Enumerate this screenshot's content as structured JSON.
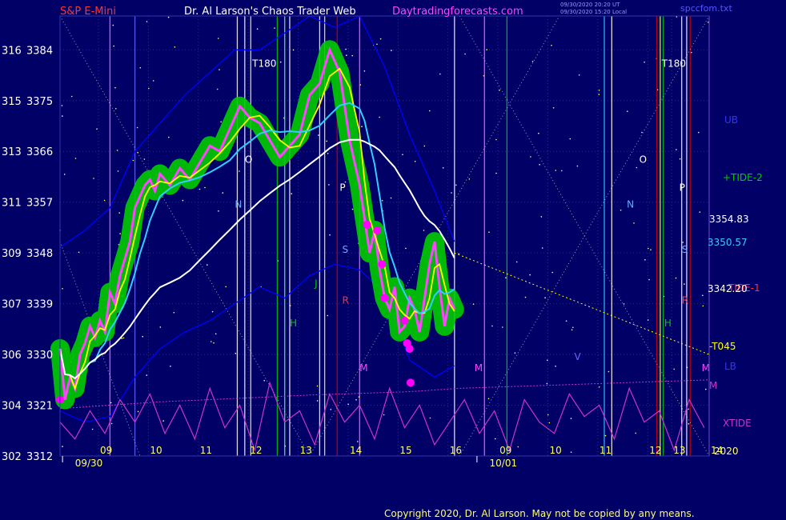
{
  "header": {
    "left": "S&P E-Mini",
    "center": "Dr. Al Larson's Chaos Trader Web",
    "site": "Daytradingforecasts.com",
    "stamp1": "09/30/2020 20:20 UT",
    "stamp2": "09/30/2020 15:20 Local",
    "file": "spccfom.txt"
  },
  "copyright": "Copyright 2020, Dr. Al Larson. May not be copied by any means.",
  "colors": {
    "background": "#000066",
    "price_green": "#00cc00",
    "price_line": "#ffff00",
    "fast_ma": "#33ccff",
    "slow_ma": "#ffffff",
    "band": "#0000ff",
    "tide2": "#00cc00",
    "xtide": "#cc33cc",
    "red_line": "#cc0000",
    "magenta_dot": "#ff00ff"
  },
  "chart_data": {
    "type": "line",
    "title": "S&P E-Mini",
    "ylim": [
      3312,
      3390
    ],
    "y_ticks": [
      {
        "left": "302",
        "right": "3312",
        "v": 3312
      },
      {
        "left": "304",
        "right": "3321",
        "v": 3321
      },
      {
        "left": "306",
        "right": "3330",
        "v": 3330
      },
      {
        "left": "307",
        "right": "3339",
        "v": 3339
      },
      {
        "left": "309",
        "right": "3348",
        "v": 3348
      },
      {
        "left": "311",
        "right": "3357",
        "v": 3357
      },
      {
        "left": "313",
        "right": "3366",
        "v": 3366
      },
      {
        "left": "315",
        "right": "3375",
        "v": 3375
      },
      {
        "left": "316",
        "right": "3384",
        "v": 3384
      }
    ],
    "x_range": [
      8,
      21
    ],
    "x_ticks": [
      {
        "t": 8.77,
        "label": "09"
      },
      {
        "t": 9.77,
        "label": "10"
      },
      {
        "t": 10.77,
        "label": "11"
      },
      {
        "t": 11.77,
        "label": "12"
      },
      {
        "t": 12.77,
        "label": "13"
      },
      {
        "t": 13.77,
        "label": "14"
      },
      {
        "t": 14.77,
        "label": "15"
      },
      {
        "t": 15.77,
        "label": "16"
      },
      {
        "t": 16.77,
        "label": "09"
      },
      {
        "t": 17.77,
        "label": "10"
      },
      {
        "t": 18.77,
        "label": "11"
      },
      {
        "t": 19.77,
        "label": "12"
      },
      {
        "t": 20.25,
        "label": "13"
      },
      {
        "t": 21.0,
        "label": "14"
      }
    ],
    "dates": [
      {
        "t": 8.3,
        "label": "09/30"
      },
      {
        "t": 16.6,
        "label": "10/01"
      }
    ],
    "year": "2020",
    "series": [
      {
        "name": "price",
        "x": [
          8.0,
          8.1,
          8.2,
          8.3,
          8.4,
          8.5,
          8.6,
          8.7,
          8.8,
          8.9,
          9.0,
          9.1,
          9.2,
          9.3,
          9.4,
          9.5,
          9.6,
          9.7,
          9.8,
          9.9,
          10.0,
          10.2,
          10.4,
          10.6,
          10.8,
          11.0,
          11.2,
          11.4,
          11.6,
          11.8,
          12.0,
          12.2,
          12.4,
          12.6,
          12.8,
          13.0,
          13.2,
          13.4,
          13.6,
          13.8,
          14.0,
          14.1,
          14.2,
          14.3,
          14.4,
          14.5,
          14.6,
          14.7,
          14.8,
          14.9,
          15.0,
          15.1,
          15.2,
          15.3,
          15.4,
          15.5,
          15.6,
          15.7,
          15.8,
          15.9
        ],
        "values": [
          3331,
          3322,
          3326,
          3324,
          3330,
          3332,
          3335,
          3333,
          3336,
          3334,
          3341,
          3339,
          3344,
          3347,
          3350,
          3356,
          3358,
          3360,
          3361,
          3359,
          3362,
          3360,
          3363,
          3361,
          3364,
          3367,
          3366,
          3370,
          3374,
          3372,
          3371,
          3368,
          3365,
          3367,
          3369,
          3376,
          3378,
          3384,
          3380,
          3368,
          3360,
          3354,
          3348,
          3352,
          3345,
          3340,
          3338,
          3342,
          3334,
          3335,
          3340,
          3338,
          3334,
          3340,
          3346,
          3350,
          3342,
          3335,
          3340,
          3338
        ]
      },
      {
        "name": "UB",
        "x": [
          8.0,
          8.5,
          9.0,
          9.5,
          10.0,
          10.5,
          11.0,
          11.5,
          12.0,
          12.5,
          13.0,
          13.5,
          14.0,
          14.5,
          15.0,
          15.5,
          15.9
        ],
        "values": [
          3349,
          3352,
          3356,
          3366,
          3371,
          3376,
          3380,
          3384,
          3384,
          3387,
          3390,
          3388,
          3390,
          3381,
          3369,
          3359,
          3350
        ]
      },
      {
        "name": "LB",
        "x": [
          8.0,
          8.5,
          9.0,
          9.5,
          10.0,
          10.5,
          11.0,
          11.5,
          12.0,
          12.5,
          13.0,
          13.5,
          14.0,
          14.5,
          15.0,
          15.5,
          15.9
        ],
        "values": [
          3320,
          3318,
          3319,
          3326,
          3331,
          3334,
          3336,
          3339,
          3342,
          3340,
          3344,
          3346,
          3345,
          3341,
          3329,
          3326,
          3328
        ]
      },
      {
        "name": "M",
        "x": [
          8.0,
          9.0,
          10.0,
          11.0,
          12.0,
          13.0,
          14.0,
          15.0,
          16.0,
          17.0,
          18.0,
          19.0,
          20.0,
          21.0
        ],
        "values": [
          3320.4,
          3321.0,
          3321.6,
          3322.0,
          3322.4,
          3322.8,
          3323.1,
          3323.4,
          3324.0,
          3324.3,
          3324.6,
          3324.9,
          3325.2,
          3325.5
        ]
      },
      {
        "name": "XTIDE",
        "x": [
          8.0,
          8.3,
          8.6,
          8.9,
          9.2,
          9.5,
          9.8,
          10.1,
          10.4,
          10.7,
          11.0,
          11.3,
          11.6,
          11.9,
          12.2,
          12.5,
          12.8,
          13.1,
          13.4,
          13.7,
          14.0,
          14.3,
          14.6,
          14.9,
          15.2,
          15.5,
          15.8,
          16.1,
          16.4,
          16.7,
          17.0,
          17.3,
          17.6,
          17.9,
          18.2,
          18.5,
          18.8,
          19.1,
          19.4,
          19.7,
          20.0,
          20.3,
          20.6,
          20.9
        ],
        "values": [
          3318,
          3315,
          3320,
          3316,
          3322,
          3318,
          3323,
          3316,
          3321,
          3315,
          3324,
          3317,
          3321,
          3313,
          3325,
          3318,
          3320,
          3314,
          3323,
          3318,
          3321,
          3315,
          3324,
          3317,
          3321,
          3314,
          3318,
          3322,
          3316,
          3320,
          3313,
          3322,
          3318,
          3316,
          3323,
          3319,
          3321,
          3315,
          3324,
          3318,
          3320,
          3313,
          3322,
          3317
        ]
      },
      {
        "name": "T045",
        "x": [
          15.9,
          21.0
        ],
        "values": [
          3348,
          3330
        ]
      }
    ],
    "right_values": [
      {
        "text": "3354.83",
        "v": 3354.83
      },
      {
        "text": "3350.57",
        "v": 3350.57
      },
      {
        "text": "3342.20",
        "v": 3342.2
      }
    ],
    "legend": [
      "UB",
      "+TIDE-2",
      "LB",
      "M",
      "XTIDE",
      "TIDE-1",
      "-T045"
    ],
    "markers": [
      {
        "text": "T180",
        "t": 11.85,
        "v": 3381
      },
      {
        "text": "T180",
        "t": 20.05,
        "v": 3381
      },
      {
        "text": "O",
        "t": 11.7,
        "v": 3364
      },
      {
        "text": "O",
        "t": 19.6,
        "v": 3364
      },
      {
        "text": "N",
        "t": 11.5,
        "v": 3356
      },
      {
        "text": "N",
        "t": 19.35,
        "v": 3356
      },
      {
        "text": "P",
        "t": 13.6,
        "v": 3359
      },
      {
        "text": "P",
        "t": 20.4,
        "v": 3359
      },
      {
        "text": "S",
        "t": 13.65,
        "v": 3348
      },
      {
        "text": "S",
        "t": 20.45,
        "v": 3348
      },
      {
        "text": "J",
        "t": 13.1,
        "v": 3342
      },
      {
        "text": "R",
        "t": 13.65,
        "v": 3339
      },
      {
        "text": "R",
        "t": 20.45,
        "v": 3339
      },
      {
        "text": "H",
        "t": 12.6,
        "v": 3335
      },
      {
        "text": "H",
        "t": 20.1,
        "v": 3335
      },
      {
        "text": "V",
        "t": 18.3,
        "v": 3329
      },
      {
        "text": "M",
        "t": 14.0,
        "v": 3327
      },
      {
        "text": "M",
        "t": 16.3,
        "v": 3327
      },
      {
        "text": "M",
        "t": 20.85,
        "v": 3327
      }
    ]
  }
}
